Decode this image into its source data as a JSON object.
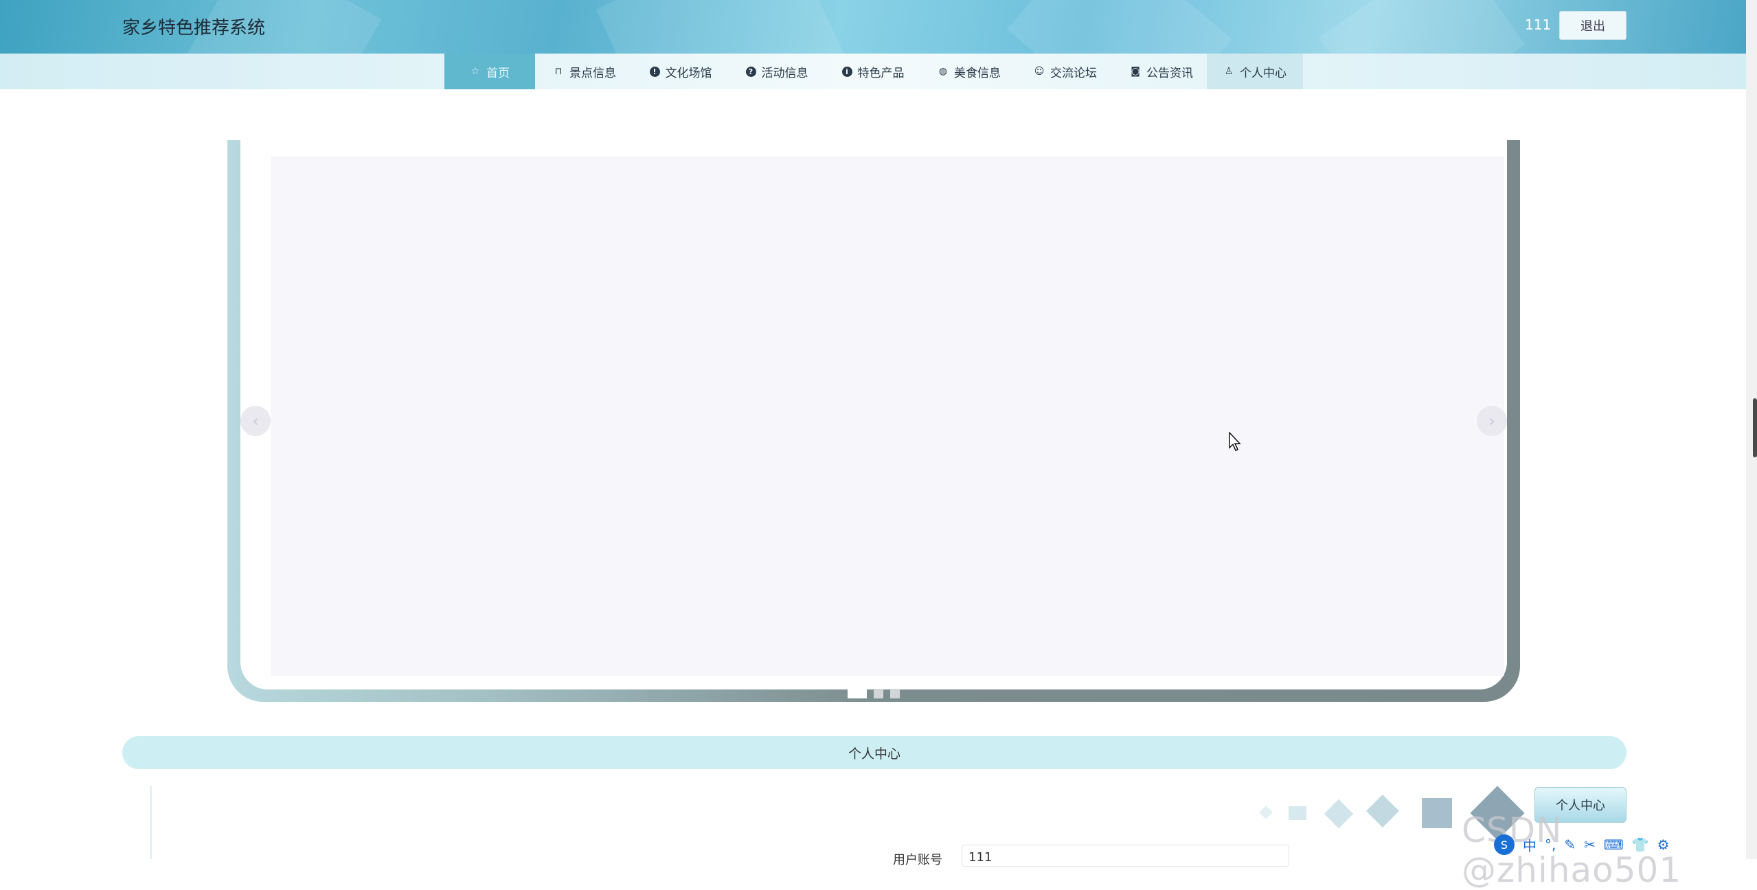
{
  "header": {
    "site_title": "家乡特色推荐系统",
    "username": "111",
    "logout_label": "退出"
  },
  "nav": {
    "items": [
      {
        "label": "首页",
        "icon": "star-icon"
      },
      {
        "label": "景点信息",
        "icon": "bag-icon"
      },
      {
        "label": "文化场馆",
        "icon": "exclamation-circle-icon"
      },
      {
        "label": "活动信息",
        "icon": "question-circle-icon"
      },
      {
        "label": "特色产品",
        "icon": "info-circle-icon"
      },
      {
        "label": "美食信息",
        "icon": "globe-icon"
      },
      {
        "label": "交流论坛",
        "icon": "smile-icon"
      },
      {
        "label": "公告资讯",
        "icon": "camera-icon"
      },
      {
        "label": "个人中心",
        "icon": "user-icon"
      }
    ],
    "active_index": 0
  },
  "carousel": {
    "prev_glyph": "‹",
    "next_glyph": "›",
    "slide_count": 3,
    "active_slide": 1
  },
  "section": {
    "title": "个人中心",
    "float_button_label": "个人中心",
    "peek_label": "用户账号",
    "peek_value": "111"
  },
  "overlay": {
    "watermark": "CSDN @zhihao501",
    "ime_items": [
      "中",
      "°,",
      "✎",
      "✂",
      "⌨",
      "👕",
      "⚙"
    ]
  },
  "colors": {
    "header_accent": "#5fb8cd",
    "section_bar": "#cdeef2",
    "frame_dark": "#7a8a8c"
  }
}
